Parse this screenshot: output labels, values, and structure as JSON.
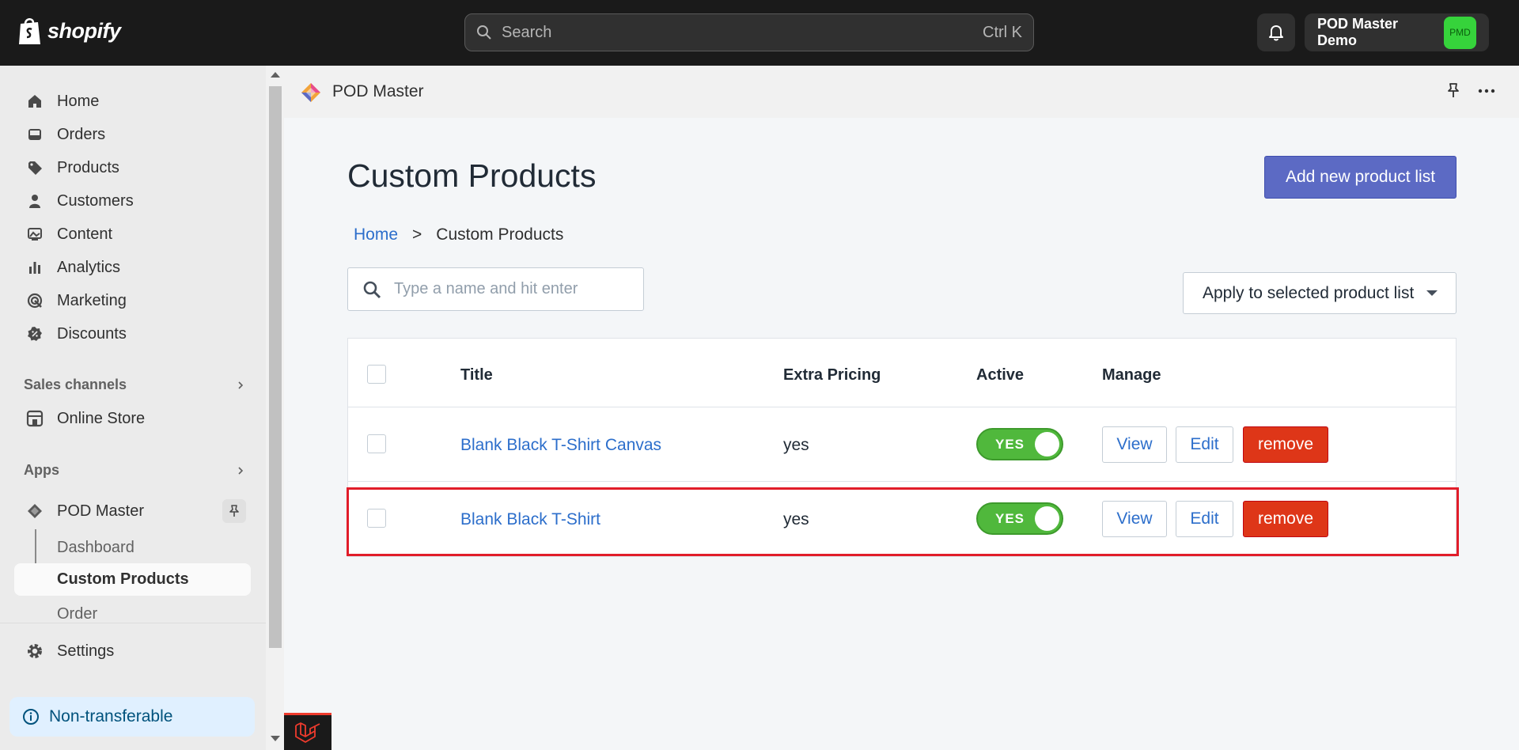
{
  "topbar": {
    "brand": "shopify",
    "search_placeholder": "Search",
    "search_shortcut": "Ctrl K",
    "store_name": "POD Master Demo",
    "store_initials": "PMD"
  },
  "sidebar": {
    "items": [
      {
        "label": "Home",
        "icon": "home-icon"
      },
      {
        "label": "Orders",
        "icon": "inbox-icon"
      },
      {
        "label": "Products",
        "icon": "tag-icon"
      },
      {
        "label": "Customers",
        "icon": "person-icon"
      },
      {
        "label": "Content",
        "icon": "image-icon"
      },
      {
        "label": "Analytics",
        "icon": "bar-chart-icon"
      },
      {
        "label": "Marketing",
        "icon": "target-icon"
      },
      {
        "label": "Discounts",
        "icon": "discount-icon"
      }
    ],
    "sales_channels_label": "Sales channels",
    "online_store_label": "Online Store",
    "apps_label": "Apps",
    "app_name": "POD Master",
    "app_subitems": [
      "Dashboard",
      "Custom Products",
      "Order"
    ],
    "active_subitem": "Custom Products",
    "settings_label": "Settings",
    "banner_label": "Non-transferable"
  },
  "app": {
    "header_title": "POD Master",
    "page_title": "Custom Products",
    "add_button": "Add new product list",
    "breadcrumb": {
      "home": "Home",
      "separator": ">",
      "current": "Custom Products"
    },
    "filter_placeholder": "Type a name and hit enter",
    "bulk_action": "Apply to selected product list",
    "table": {
      "headers": {
        "title": "Title",
        "extra_pricing": "Extra Pricing",
        "active": "Active",
        "manage": "Manage"
      },
      "rows": [
        {
          "title": "Blank Black T-Shirt Canvas",
          "extra_pricing": "yes",
          "active": "YES",
          "view": "View",
          "edit": "Edit",
          "remove": "remove"
        },
        {
          "title": "Blank Black T-Shirt",
          "extra_pricing": "yes",
          "active": "YES",
          "view": "View",
          "edit": "Edit",
          "remove": "remove"
        }
      ]
    }
  },
  "colors": {
    "primary": "#5c6ac4",
    "link": "#2c6ecb",
    "danger": "#de3618",
    "toggle_on": "#50b83c",
    "highlight": "#e11d2a"
  }
}
